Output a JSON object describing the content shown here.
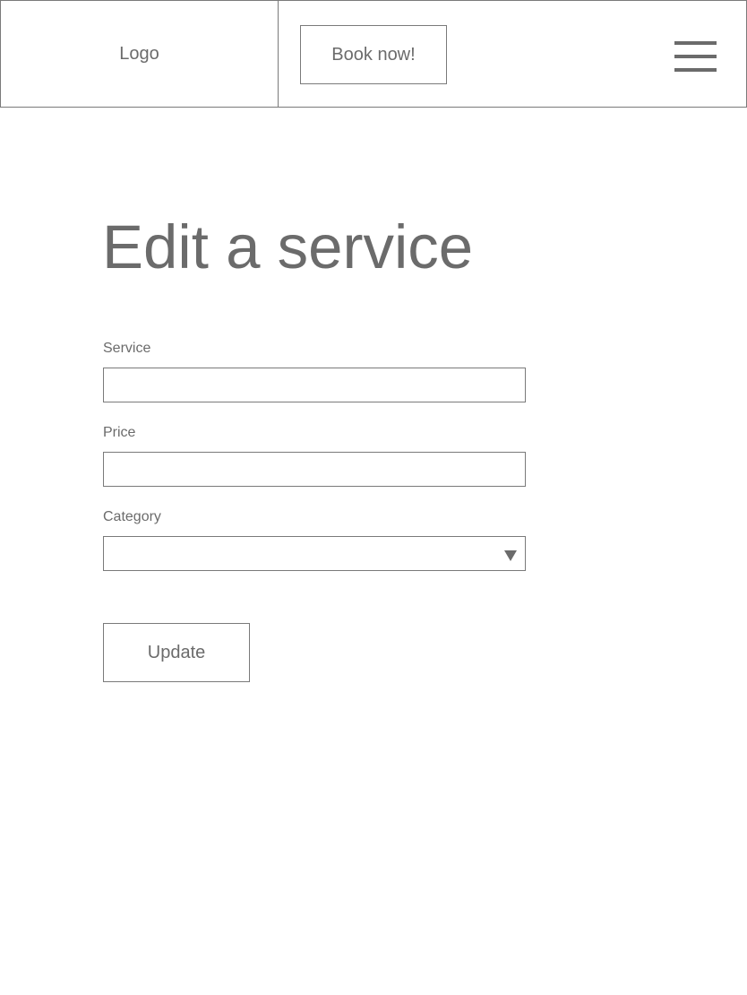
{
  "header": {
    "logo_text": "Logo",
    "book_label": "Book now!",
    "menu_icon": "hamburger-menu-icon"
  },
  "page": {
    "title": "Edit a service"
  },
  "form": {
    "service": {
      "label": "Service",
      "value": ""
    },
    "price": {
      "label": "Price",
      "value": ""
    },
    "category": {
      "label": "Category",
      "selected": "",
      "arrow_icon": "dropdown-arrow-icon"
    },
    "submit_label": "Update"
  },
  "colors": {
    "text": "#6b6b6b",
    "border": "#7a7a7a",
    "background": "#ffffff"
  }
}
